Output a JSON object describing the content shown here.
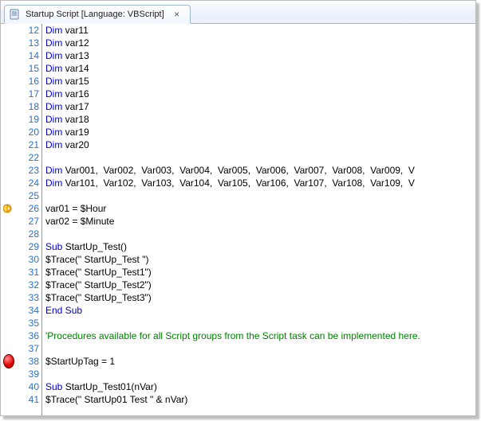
{
  "tab": {
    "title": "Startup Script [Language: VBScript]",
    "close_label": "×"
  },
  "lines": [
    {
      "n": 12,
      "segs": [
        {
          "c": "kw",
          "t": "Dim "
        },
        {
          "c": "txt",
          "t": "var11"
        }
      ]
    },
    {
      "n": 13,
      "segs": [
        {
          "c": "kw",
          "t": "Dim "
        },
        {
          "c": "txt",
          "t": "var12"
        }
      ]
    },
    {
      "n": 14,
      "segs": [
        {
          "c": "kw",
          "t": "Dim "
        },
        {
          "c": "txt",
          "t": "var13"
        }
      ]
    },
    {
      "n": 15,
      "segs": [
        {
          "c": "kw",
          "t": "Dim "
        },
        {
          "c": "txt",
          "t": "var14"
        }
      ]
    },
    {
      "n": 16,
      "segs": [
        {
          "c": "kw",
          "t": "Dim "
        },
        {
          "c": "txt",
          "t": "var15"
        }
      ]
    },
    {
      "n": 17,
      "segs": [
        {
          "c": "kw",
          "t": "Dim "
        },
        {
          "c": "txt",
          "t": "var16"
        }
      ]
    },
    {
      "n": 18,
      "segs": [
        {
          "c": "kw",
          "t": "Dim "
        },
        {
          "c": "txt",
          "t": "var17"
        }
      ]
    },
    {
      "n": 19,
      "segs": [
        {
          "c": "kw",
          "t": "Dim "
        },
        {
          "c": "txt",
          "t": "var18"
        }
      ]
    },
    {
      "n": 20,
      "segs": [
        {
          "c": "kw",
          "t": "Dim "
        },
        {
          "c": "txt",
          "t": "var19"
        }
      ]
    },
    {
      "n": 21,
      "segs": [
        {
          "c": "kw",
          "t": "Dim "
        },
        {
          "c": "txt",
          "t": "var20"
        }
      ]
    },
    {
      "n": 22,
      "segs": [
        {
          "c": "txt",
          "t": " "
        }
      ]
    },
    {
      "n": 23,
      "segs": [
        {
          "c": "kw",
          "t": "Dim "
        },
        {
          "c": "txt",
          "t": "Var001,  Var002,  Var003,  Var004,  Var005,  Var006,  Var007,  Var008,  Var009,  V"
        }
      ]
    },
    {
      "n": 24,
      "segs": [
        {
          "c": "kw",
          "t": "Dim "
        },
        {
          "c": "txt",
          "t": "Var101,  Var102,  Var103,  Var104,  Var105,  Var106,  Var107,  Var108,  Var109,  V"
        }
      ]
    },
    {
      "n": 25,
      "segs": [
        {
          "c": "txt",
          "t": " "
        }
      ]
    },
    {
      "n": 26,
      "marker": "arrow",
      "segs": [
        {
          "c": "txt",
          "t": "var01 = $Hour"
        }
      ]
    },
    {
      "n": 27,
      "segs": [
        {
          "c": "txt",
          "t": "var02 = $Minute"
        }
      ]
    },
    {
      "n": 28,
      "segs": [
        {
          "c": "txt",
          "t": " "
        }
      ]
    },
    {
      "n": 29,
      "segs": [
        {
          "c": "kw",
          "t": "Sub "
        },
        {
          "c": "txt",
          "t": "StartUp_Test()"
        }
      ]
    },
    {
      "n": 30,
      "segs": [
        {
          "c": "txt",
          "t": "$Trace(\" StartUp_Test \")"
        }
      ]
    },
    {
      "n": 31,
      "segs": [
        {
          "c": "txt",
          "t": "$Trace(\" StartUp_Test1\")"
        }
      ]
    },
    {
      "n": 32,
      "segs": [
        {
          "c": "txt",
          "t": "$Trace(\" StartUp_Test2\")"
        }
      ]
    },
    {
      "n": 33,
      "segs": [
        {
          "c": "txt",
          "t": "$Trace(\" StartUp_Test3\")"
        }
      ]
    },
    {
      "n": 34,
      "segs": [
        {
          "c": "kw",
          "t": "End Sub"
        }
      ]
    },
    {
      "n": 35,
      "segs": [
        {
          "c": "txt",
          "t": " "
        }
      ]
    },
    {
      "n": 36,
      "segs": [
        {
          "c": "cmt",
          "t": "'Procedures available for all Script groups from the Script task can be implemented here."
        }
      ]
    },
    {
      "n": 37,
      "segs": [
        {
          "c": "txt",
          "t": " "
        }
      ]
    },
    {
      "n": 38,
      "marker": "break",
      "segs": [
        {
          "c": "txt",
          "t": "$StartUpTag = 1"
        }
      ]
    },
    {
      "n": 39,
      "segs": [
        {
          "c": "txt",
          "t": " "
        }
      ]
    },
    {
      "n": 40,
      "segs": [
        {
          "c": "kw",
          "t": "Sub "
        },
        {
          "c": "txt",
          "t": "StartUp_Test01(nVar)"
        }
      ]
    },
    {
      "n": 41,
      "segs": [
        {
          "c": "txt",
          "t": "$Trace(\" StartUp01 Test \" & nVar)"
        }
      ]
    }
  ]
}
